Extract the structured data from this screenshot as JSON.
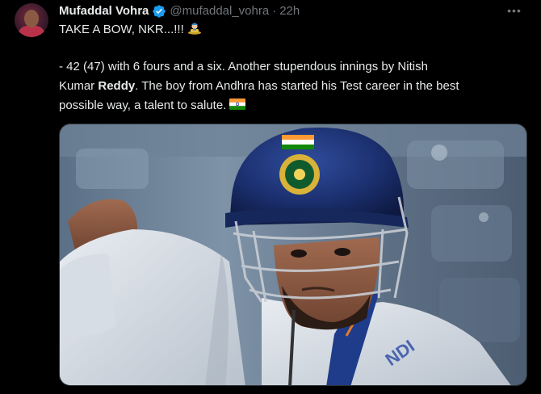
{
  "tweet": {
    "author_name": "Mufaddal Vohra",
    "handle": "@mufaddal_vohra",
    "separator": "·",
    "time": "22h",
    "more_label": "•••",
    "line1": "TAKE A BOW, NKR...!!!",
    "line2": "- 42 (47) with 6 fours and a six. Another stupendous innings by Nitish",
    "line3_pre": "Kumar ",
    "line3_bold": "Reddy",
    "line3_post": ". The boy from Andhra has started his Test career in the best",
    "line4": "possible way, a talent to salute.",
    "icons": {
      "verified": "verified-badge-icon",
      "more": "more-options-icon",
      "line1_emoji": "genie-emoji",
      "line4_emoji": "india-flag-emoji"
    },
    "colors": {
      "background": "#000000",
      "text": "#e7e9ea",
      "secondary": "#71767b",
      "verified": "#1d9bf0"
    }
  }
}
